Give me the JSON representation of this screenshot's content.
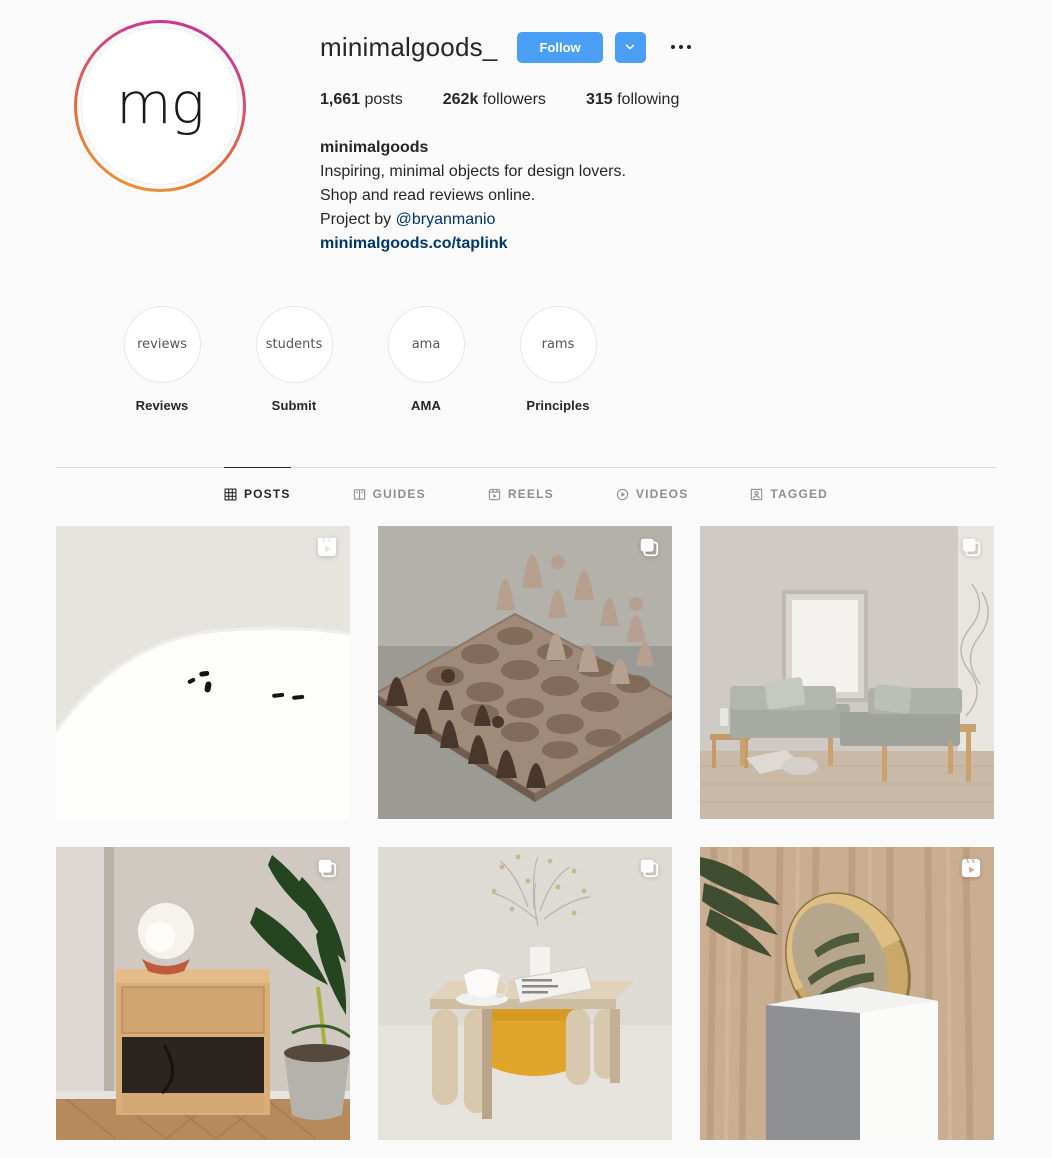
{
  "profile": {
    "avatar_monogram": "mg",
    "avatar_icon": "profile-avatar-story-ring",
    "username": "minimalgoods_",
    "follow_label": "Follow",
    "caret_icon": "chevron-down-icon",
    "more_icon": "more-options-icon",
    "stats": [
      {
        "value": "1,661",
        "label": "posts",
        "name": "posts"
      },
      {
        "value": "262k",
        "label": "followers",
        "name": "followers"
      },
      {
        "value": "315",
        "label": "following",
        "name": "following"
      }
    ],
    "bio": {
      "full_name": "minimalgoods",
      "line1": "Inspiring, minimal objects for design lovers.",
      "line2": "Shop and read reviews online.",
      "line3_prefix": "Project by ",
      "mention": "@bryanmanio",
      "link": "minimalgoods.co/taplink"
    }
  },
  "highlights": [
    {
      "cover_text": "reviews",
      "label": "Reviews"
    },
    {
      "cover_text": "students",
      "label": "Submit"
    },
    {
      "cover_text": "ama",
      "label": "AMA"
    },
    {
      "cover_text": "rams",
      "label": "Principles"
    }
  ],
  "tabs": [
    {
      "label": "POSTS",
      "icon": "grid-icon",
      "active": true
    },
    {
      "label": "GUIDES",
      "icon": "book-icon",
      "active": false
    },
    {
      "label": "REELS",
      "icon": "reels-icon",
      "active": false
    },
    {
      "label": "VIDEOS",
      "icon": "video-icon",
      "active": false
    },
    {
      "label": "TAGGED",
      "icon": "tagged-icon",
      "active": false
    }
  ],
  "posts": [
    {
      "name": "post-white-curved-object",
      "badge": "reels-icon",
      "alt": "White curved form on beige background with small dark marks"
    },
    {
      "name": "post-wooden-chess-set",
      "badge": "carousel-icon",
      "alt": "Wooden chess set with conical pieces on grey surface"
    },
    {
      "name": "post-grey-sectional-sofa",
      "badge": "carousel-icon",
      "alt": "Grey sectional sofa with wood frame and leaning mirror"
    },
    {
      "name": "post-oak-nightstand-lamp",
      "badge": "carousel-icon",
      "alt": "Oak nightstand with globe lamp and potted plant"
    },
    {
      "name": "post-wood-table-yellow",
      "badge": "carousel-icon",
      "alt": "Light wood table with yellow panel, coffee cup and vase"
    },
    {
      "name": "post-brass-bowl-pedestal",
      "badge": "reels-icon",
      "alt": "Brass bowl on white pedestal against curtain with palm leaf"
    }
  ],
  "colors": {
    "page_background": "#fafafa",
    "accent_blue": "#4a9ff5",
    "link_blue": "#00376b",
    "text_primary": "#262626",
    "text_muted": "#8e8e8e",
    "divider": "#dbdbdb"
  }
}
